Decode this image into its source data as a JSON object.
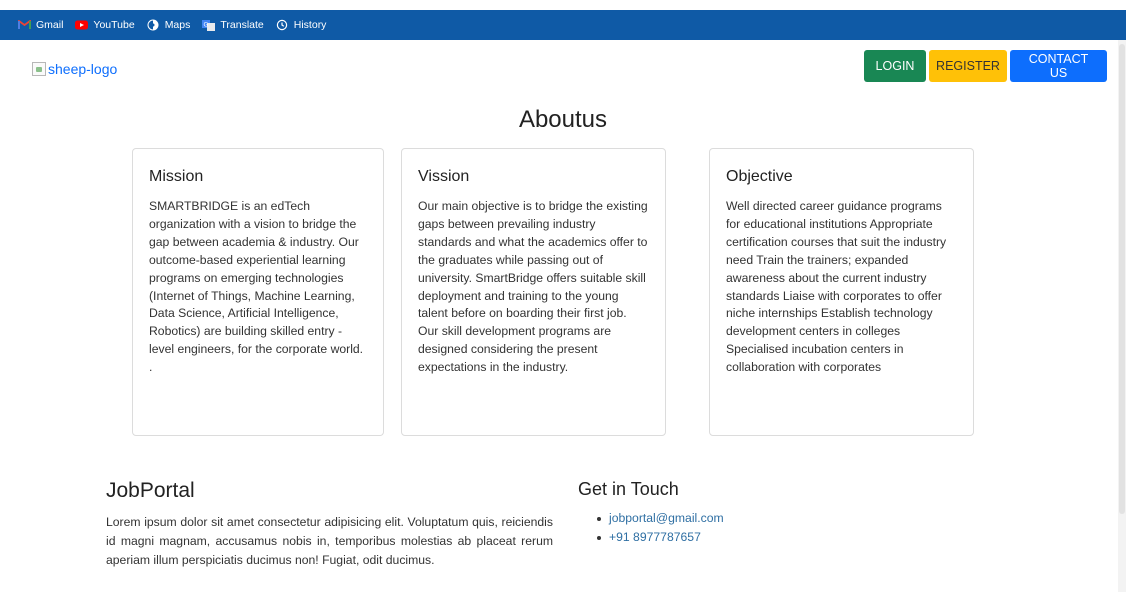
{
  "bookmarks": [
    {
      "label": "Gmail",
      "icon": "gmail-icon"
    },
    {
      "label": "YouTube",
      "icon": "youtube-icon"
    },
    {
      "label": "Maps",
      "icon": "maps-icon"
    },
    {
      "label": "Translate",
      "icon": "translate-icon"
    },
    {
      "label": "History",
      "icon": "history-icon"
    }
  ],
  "header": {
    "logo_alt": "sheep-logo",
    "login": "LOGIN",
    "register": "REGISTER",
    "contact": "CONTACT US"
  },
  "about": {
    "title": "Aboutus",
    "cards": [
      {
        "title": "Mission",
        "text": "SMARTBRIDGE is an edTech organization with a vision to bridge the gap between academia & industry. Our outcome-based experiential learning programs on emerging technologies (Internet of Things, Machine Learning, Data Science, Artificial Intelligence, Robotics) are building skilled entry -level engineers, for the corporate world. ."
      },
      {
        "title": "Vission",
        "text": "Our main objective is to bridge the existing gaps between prevailing industry standards and what the academics offer to the graduates while passing out of university. SmartBridge offers suitable skill deployment and training to the young talent before on boarding their first job. Our skill development programs are designed considering the present expectations in the industry."
      },
      {
        "title": "Objective",
        "text": "Well directed career guidance programs for educational institutions Appropriate certification courses that suit the industry need Train the trainers; expanded awareness about the current industry standards Liaise with corporates to offer niche internships Establish technology development centers in colleges Specialised incubation centers in collaboration with corporates"
      }
    ]
  },
  "footer": {
    "brand": "JobPortal",
    "description": "Lorem ipsum dolor sit amet consectetur adipisicing elit. Voluptatum quis, reiciendis id magni magnam, accusamus nobis in, temporibus molestias ab placeat rerum aperiam illum perspiciatis ducimus non! Fugiat, odit ducimus.",
    "contact_title": "Get in Touch",
    "email": "jobportal@gmail.com",
    "phone": "+91 8977787657"
  },
  "colors": {
    "bookmarks_bar": "#0f5aa6",
    "login": "#198754",
    "register": "#ffc107",
    "contact": "#0d6efd",
    "link": "#2f6fa3"
  }
}
